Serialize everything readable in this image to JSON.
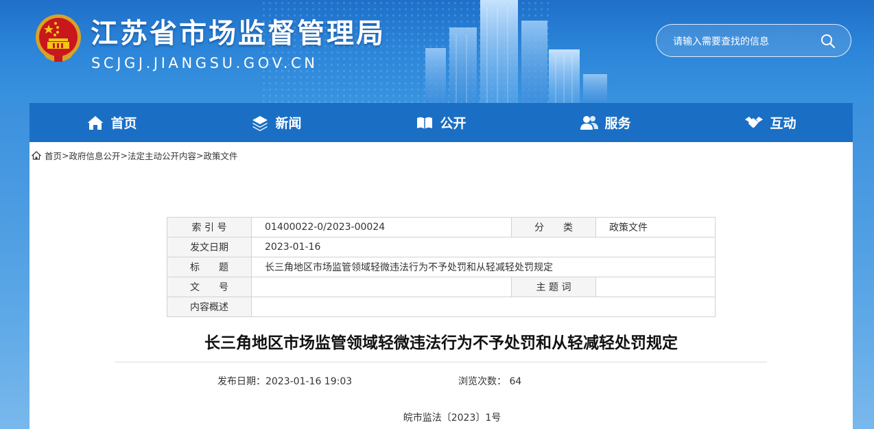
{
  "header": {
    "site_title": "江苏省市场监督管理局",
    "site_domain": "SCJGJ.JIANGSU.GOV.CN",
    "search_placeholder": "请输入需要查找的信息"
  },
  "nav": {
    "items": [
      {
        "label": "首页",
        "icon": "home-icon"
      },
      {
        "label": "新闻",
        "icon": "layers-icon"
      },
      {
        "label": "公开",
        "icon": "open-book-icon"
      },
      {
        "label": "服务",
        "icon": "users-icon"
      },
      {
        "label": "互动",
        "icon": "handshake-icon"
      }
    ]
  },
  "breadcrumb": {
    "items": [
      "首页",
      "政府信息公开",
      "法定主动公开内容",
      "政策文件"
    ],
    "separator": ">"
  },
  "meta_table": {
    "index_label": "索 引 号",
    "index_value": "01400022-0/2023-00024",
    "category_label": "分　　类",
    "category_value": "政策文件",
    "date_label": "发文日期",
    "date_value": "2023-01-16",
    "title_label": "标　　题",
    "title_value": "长三角地区市场监管领域轻微违法行为不予处罚和从轻减轻处罚规定",
    "docnum_label": "文　　号",
    "docnum_value": "",
    "keywords_label": "主 题 词",
    "keywords_value": "",
    "summary_label": "内容概述",
    "summary_value": ""
  },
  "article": {
    "title": "长三角地区市场监管领域轻微违法行为不予处罚和从轻减轻处罚规定",
    "publish_date": "发布日期：2023-01-16 19:03",
    "views": "浏览次数： 64",
    "doc_number": "皖市监法〔2023〕1号"
  },
  "colors": {
    "nav_bg": "#1a6fc5",
    "header_bg": "#2b84d8",
    "table_border": "#d2d2d2",
    "label_bg": "#f5f5f5"
  }
}
